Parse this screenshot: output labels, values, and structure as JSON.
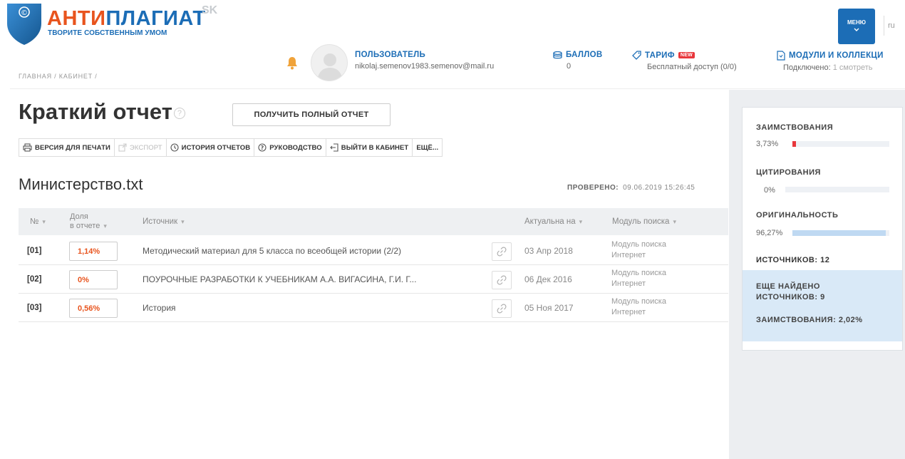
{
  "header": {
    "logo": {
      "title_part1": "АНТИ",
      "title_part2": "ПЛАГИАТ",
      "subtitle": "ТВОРИТЕ СОБСТВЕННЫМ УМОМ"
    },
    "partner_logo": "SK",
    "breadcrumb": "ГЛАВНАЯ / КАБИНЕТ /",
    "user": {
      "label": "ПОЛЬЗОВАТЕЛЬ",
      "email": "nikolaj.semenov1983.semenov@mail.ru"
    },
    "points": {
      "label": "БАЛЛОВ",
      "value": "0"
    },
    "tariff": {
      "label": "ТАРИФ",
      "badge": "NEW",
      "value": "Бесплатный доступ (0/0)"
    },
    "modules": {
      "label": "МОДУЛИ И КОЛЛЕКЦИ",
      "value_prefix": "Подключено:",
      "value_link": "1 смотреть"
    },
    "menu_label": "МЕНЮ",
    "lang": "ru"
  },
  "report": {
    "title": "Краткий отчет",
    "full_report_button": "ПОЛУЧИТЬ ПОЛНЫЙ ОТЧЕТ",
    "toolbar": {
      "print": "ВЕРСИЯ ДЛЯ ПЕЧАТИ",
      "export": "ЭКСПОРТ",
      "history": "ИСТОРИЯ ОТЧЕТОВ",
      "guide": "РУКОВОДСТВО",
      "exit": "ВЫЙТИ В КАБИНЕТ",
      "more": "ЕЩЁ..."
    },
    "document_name": "Министерство.txt",
    "checked_label": "ПРОВЕРЕНО:",
    "checked_value": "09.06.2019 15:26:45"
  },
  "table": {
    "headers": {
      "num": "№",
      "share_line1": "Доля",
      "share_line2": "в отчете",
      "source": "Источник",
      "actual": "Актуальна на",
      "module": "Модуль поиска"
    },
    "rows": [
      {
        "num": "[01]",
        "share": "1,14%",
        "source": "Методический материал для 5 класса по всеобщей истории (2/2)",
        "date": "03 Апр 2018",
        "module_line1": "Модуль поиска",
        "module_line2": "Интернет"
      },
      {
        "num": "[02]",
        "share": "0%",
        "source": "ПОУРОЧНЫЕ РАЗРАБОТКИ К УЧЕБНИКАМ А.А. ВИГАСИНА, Г.И. Г...",
        "date": "06 Дек 2016",
        "module_line1": "Модуль поиска",
        "module_line2": "Интернет"
      },
      {
        "num": "[03]",
        "share": "0,56%",
        "source": "История",
        "date": "05 Ноя 2017",
        "module_line1": "Модуль поиска",
        "module_line2": "Интернет"
      }
    ]
  },
  "sidebar": {
    "borrowings": {
      "label": "ЗАИМСТВОВАНИЯ",
      "value": "3,73%",
      "fraction": 0.0373,
      "color": "#e8373c"
    },
    "citations": {
      "label": "ЦИТИРОВАНИЯ",
      "value": "0%",
      "fraction": 0.0,
      "color": "#bfd9f2"
    },
    "originality": {
      "label": "ОРИГИНАЛЬНОСТЬ",
      "value": "96,27%",
      "fraction": 0.9627,
      "color": "#bfd9f2"
    },
    "sources": "ИСТОЧНИКОВ: 12",
    "more_found": "ЕЩЕ НАЙДЕНО ИСТОЧНИКОВ: 9",
    "more_borrowings": "ЗАИМСТВОВАНИЯ: 2,02%"
  }
}
